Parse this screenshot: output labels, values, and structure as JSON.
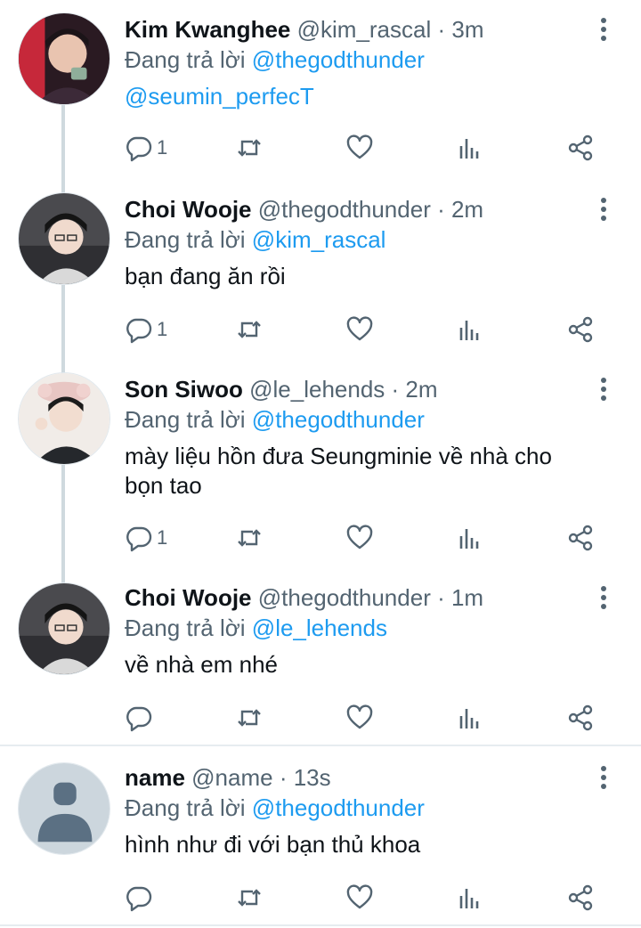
{
  "tweets": [
    {
      "name": "Kim Kwanghee",
      "handle": "@kim_rascal",
      "time": "· 3m",
      "reply_prefix": "Đang trả lời",
      "reply_to": "@thegodthunder",
      "body_lines": [
        "@seumin_perfecT"
      ],
      "body_is_mention": true,
      "reply_count": "1"
    },
    {
      "name": "Choi Wooje",
      "handle": "@thegodthunder",
      "time": "· 2m",
      "reply_prefix": "Đang trả lời",
      "reply_to": "@kim_rascal",
      "body_lines": [
        "bạn đang ăn rồi"
      ],
      "body_is_mention": false,
      "reply_count": "1"
    },
    {
      "name": "Son Siwoo",
      "handle": "@le_lehends",
      "time": "· 2m",
      "reply_prefix": "Đang trả lời",
      "reply_to": "@thegodthunder",
      "body_lines": [
        "mày liệu hồn đưa Seungminie về nhà cho",
        "bọn tao"
      ],
      "body_is_mention": false,
      "reply_count": "1"
    },
    {
      "name": "Choi Wooje",
      "handle": "@thegodthunder",
      "time": "· 1m",
      "reply_prefix": "Đang trả lời",
      "reply_to": "@le_lehends",
      "body_lines": [
        "về nhà em nhé"
      ],
      "body_is_mention": false,
      "reply_count": ""
    },
    {
      "name": "name",
      "handle": "@name",
      "time": "· 13s",
      "reply_prefix": "Đang trả lời",
      "reply_to": "@thegodthunder",
      "body_lines": [
        "hình như đi với bạn thủ khoa"
      ],
      "body_is_mention": false,
      "reply_count": ""
    }
  ],
  "icons": {
    "reply": "reply-icon",
    "retweet": "retweet-icon",
    "like": "heart-icon",
    "views": "bar-chart-icon",
    "share": "share-icon",
    "more": "more-vertical-icon"
  },
  "colors": {
    "mention": "#1d9bf0",
    "text": "#0f1419",
    "muted": "#536471",
    "thread_line": "#cfd9de",
    "divider": "#e6ecf0"
  }
}
